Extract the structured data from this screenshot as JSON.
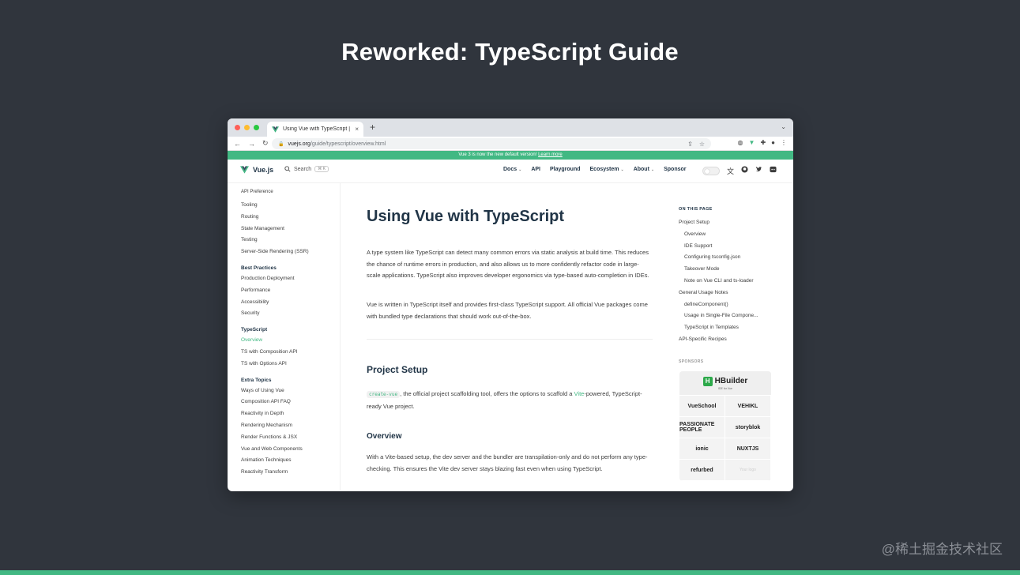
{
  "slide": {
    "title": "Reworked: TypeScript Guide",
    "watermark": "@稀土掘金技术社区"
  },
  "browser": {
    "tab_title": "Using Vue with TypeScript | V...",
    "tab_close": "×",
    "new_tab": "+",
    "url_host": "vuejs.org",
    "url_path": "/guide/typescript/overview.html"
  },
  "banner": {
    "text": "Vue 3 is now the new default version! ",
    "link": "Learn more"
  },
  "nav": {
    "brand": "Vue.js",
    "search_label": "Search",
    "search_kbd": "⌘ K",
    "menu": [
      {
        "label": "Docs",
        "caret": true
      },
      {
        "label": "API",
        "caret": false
      },
      {
        "label": "Playground",
        "caret": false
      },
      {
        "label": "Ecosystem",
        "caret": true
      },
      {
        "label": "About",
        "caret": true
      },
      {
        "label": "Sponsor",
        "caret": false
      }
    ]
  },
  "sidebar": {
    "top": "API Preference",
    "groups": [
      {
        "title": "",
        "items": [
          "Tooling",
          "Routing",
          "State Management",
          "Testing",
          "Server-Side Rendering (SSR)"
        ]
      },
      {
        "title": "Best Practices",
        "items": [
          "Production Deployment",
          "Performance",
          "Accessibility",
          "Security"
        ]
      },
      {
        "title": "TypeScript",
        "items": [
          "Overview",
          "TS with Composition API",
          "TS with Options API"
        ],
        "active": "Overview"
      },
      {
        "title": "Extra Topics",
        "items": [
          "Ways of Using Vue",
          "Composition API FAQ",
          "Reactivity in Depth",
          "Rendering Mechanism",
          "Render Functions & JSX",
          "Vue and Web Components",
          "Animation Techniques",
          "Reactivity Transform"
        ]
      }
    ]
  },
  "main": {
    "title": "Using Vue with TypeScript",
    "p1": "A type system like TypeScript can detect many common errors via static analysis at build time. This reduces the chance of runtime errors in production, and also allows us to more confidently refactor code in large-scale applications. TypeScript also improves developer ergonomics via type-based auto-completion in IDEs.",
    "p2": "Vue is written in TypeScript itself and provides first-class TypeScript support. All official Vue packages come with bundled type declarations that should work out-of-the-box.",
    "h2": "Project Setup",
    "p3_code": "create-vue",
    "p3_mid": ", the official project scaffolding tool, offers the options to scaffold a ",
    "p3_link": "Vite",
    "p3_end": "-powered, TypeScript-ready Vue project.",
    "h3": "Overview",
    "p4": "With a Vite-based setup, the dev server and the bundler are transpilation-only and do not perform any type-checking. This ensures the Vite dev server stays blazing fast even when using TypeScript."
  },
  "toc": {
    "heading": "ON THIS PAGE",
    "items": [
      {
        "label": "Project Setup",
        "level": 1
      },
      {
        "label": "Overview",
        "level": 2
      },
      {
        "label": "IDE Support",
        "level": 2
      },
      {
        "label": "Configuring tsconfig.json",
        "level": 2
      },
      {
        "label": "Takeover Mode",
        "level": 2
      },
      {
        "label": "Note on Vue CLI and ts-loader",
        "level": 2
      },
      {
        "label": "General Usage Notes",
        "level": 1
      },
      {
        "label": "defineComponent()",
        "level": 2
      },
      {
        "label": "Usage in Single-File Compone...",
        "level": 2
      },
      {
        "label": "TypeScript in Templates",
        "level": 2
      },
      {
        "label": "API-Specific Recipes",
        "level": 1
      }
    ]
  },
  "sponsors": {
    "heading": "SPONSORS",
    "top": {
      "name": "HBuilder",
      "tagline": "IDE for Vue",
      "mark": "H"
    },
    "grid": [
      "VueSchool",
      "VEHIKL",
      "PASSIONATE PEOPLE",
      "storyblok",
      "ionic",
      "NUXTJS",
      "refurbed",
      "Your logo"
    ]
  },
  "colors": {
    "accent": "#42b883",
    "text": "#213547",
    "background": "#30353d"
  }
}
